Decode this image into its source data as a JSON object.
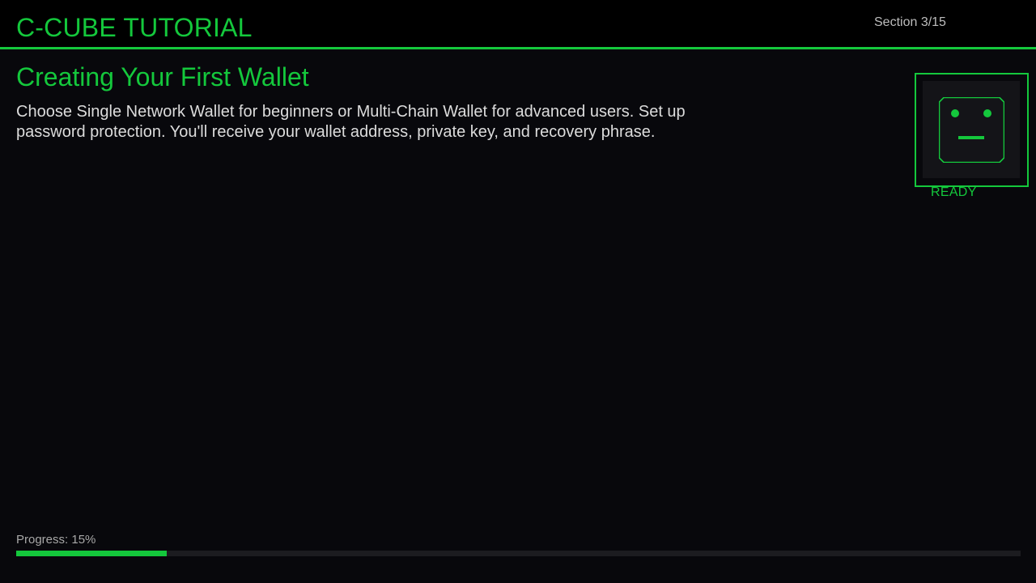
{
  "header": {
    "app_title": "C-CUBE TUTORIAL",
    "section_counter": "Section 3/15"
  },
  "lesson": {
    "title": "Creating Your First Wallet",
    "description": "Choose Single Network Wallet for beginners or Multi-Chain Wallet for advanced users. Set up password protection. You'll receive your wallet address, private key, and recovery phrase."
  },
  "assistant": {
    "icon": "robot-face-icon",
    "status": "READY"
  },
  "progress": {
    "label": "Progress: 15%",
    "percent": 15
  },
  "colors": {
    "accent": "#14c83c",
    "background": "#08080c",
    "header_background": "#000000",
    "text": "#dcdcdc",
    "muted_text": "#a8a8a8",
    "track": "#1c1c20"
  }
}
